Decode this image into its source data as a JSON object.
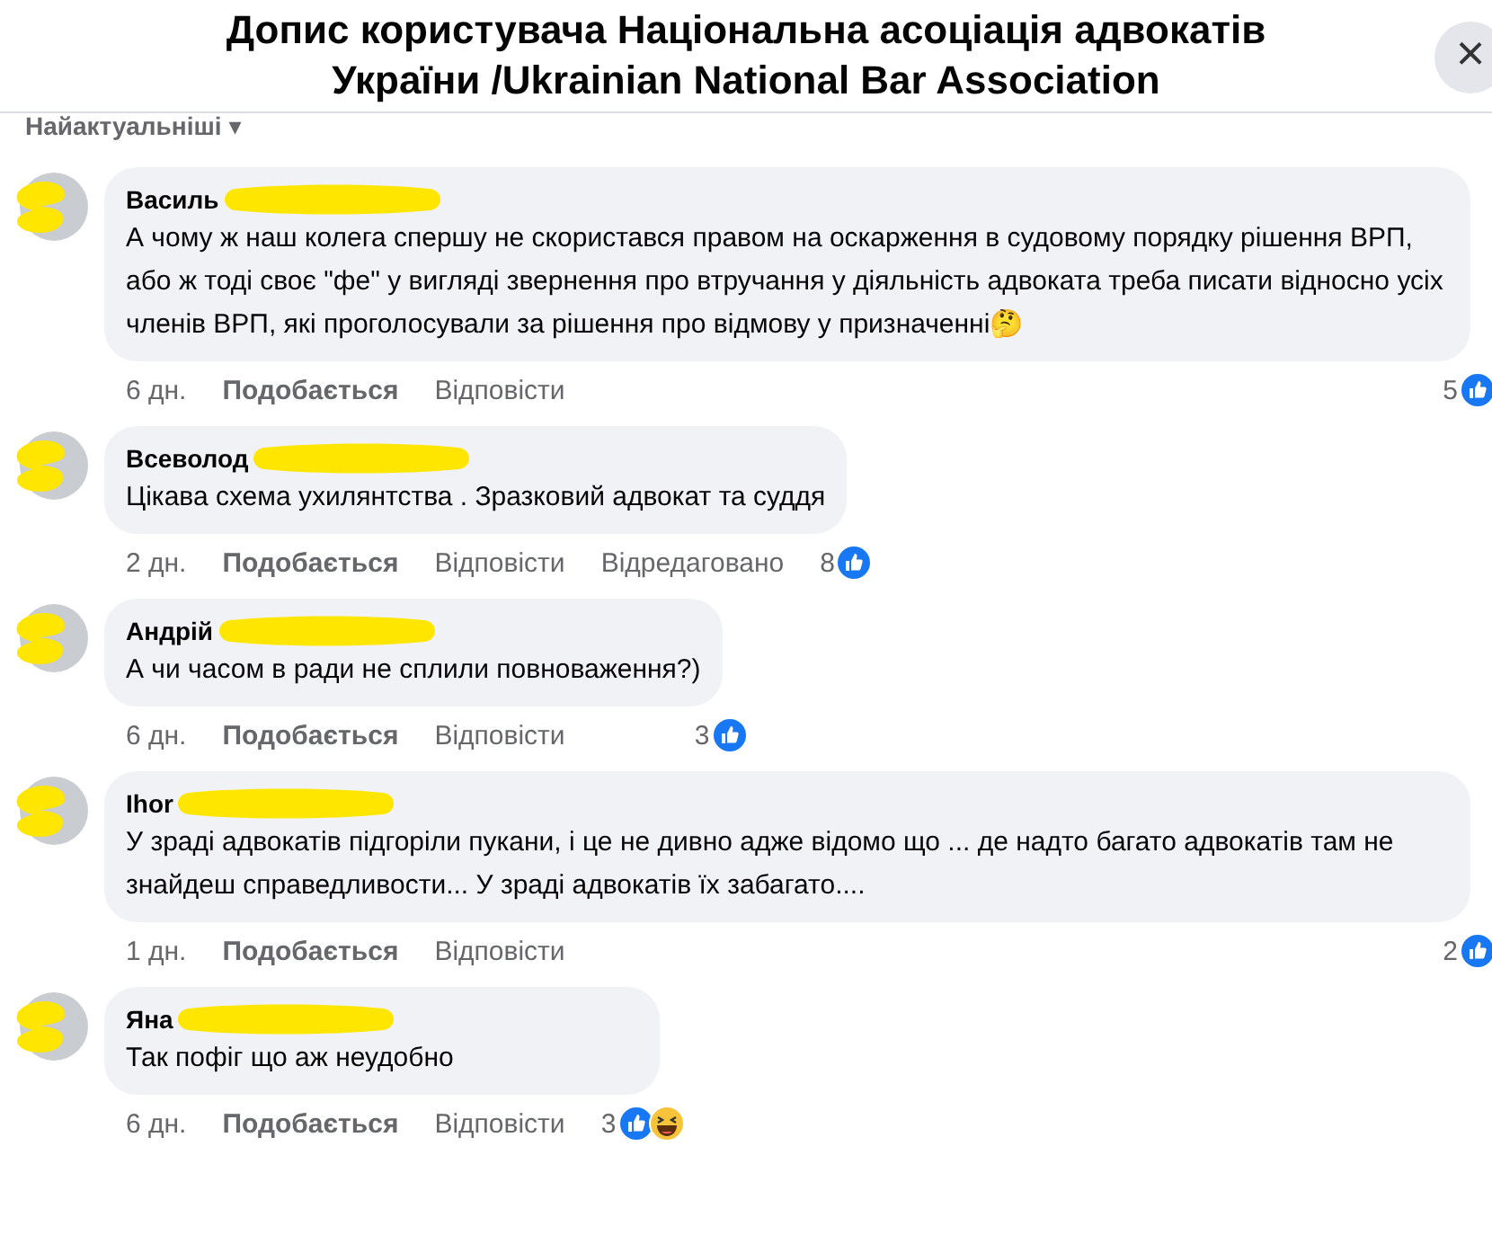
{
  "header": {
    "title": "Допис користувача Національна асоціація адвокатів України /Ukrainian National Bar Association",
    "close": "×"
  },
  "sort": {
    "label": "Найактуальніші",
    "caret": "▾"
  },
  "comments": [
    {
      "author": "Василь",
      "text": "А чому ж наш колега спершу не скористався правом на оскарження в судовому порядку рішення ВРП, або ж тоді своє \"фе\" у вигляді звернення про втручання у діяльність адвоката треба писати відносно усіх членів ВРП, які проголосували за рішення про відмову у призначенні🤔",
      "time": "6 дн.",
      "like": "Подобається",
      "reply": "Відповісти",
      "likes": "5",
      "reactions": [
        {
          "kind": "like"
        }
      ]
    },
    {
      "author": "Всеволод",
      "text": "Цікава схема ухилянтства . Зразковий адвокат та суддя",
      "time": "2 дн.",
      "like": "Подобається",
      "reply": "Відповісти",
      "edited": "Відредаговано",
      "likes": "8",
      "reactions": [
        {
          "kind": "like"
        }
      ]
    },
    {
      "author": "Андрій",
      "text": "А чи часом в ради не сплили повноваження?)",
      "time": "6 дн.",
      "like": "Подобається",
      "reply": "Відповісти",
      "likes": "3",
      "reactions": [
        {
          "kind": "like"
        }
      ]
    },
    {
      "author": "Ihor",
      "text": "У зраді адвокатів підгоріли пукани, і це не дивно адже відомо що ... де надто багато адвокатів там не знайдеш справедливости... У зраді адвокатів їх забагато....",
      "time": "1 дн.",
      "like": "Подобається",
      "reply": "Відповісти",
      "likes": "2",
      "reactions": [
        {
          "kind": "like"
        }
      ]
    },
    {
      "author": "Яна",
      "text": "Так пофіг що аж неудобно",
      "time": "6 дн.",
      "like": "Подобається",
      "reply": "Відповісти",
      "likes": "3",
      "reactions": [
        {
          "kind": "like"
        },
        {
          "kind": "haha"
        }
      ]
    }
  ]
}
